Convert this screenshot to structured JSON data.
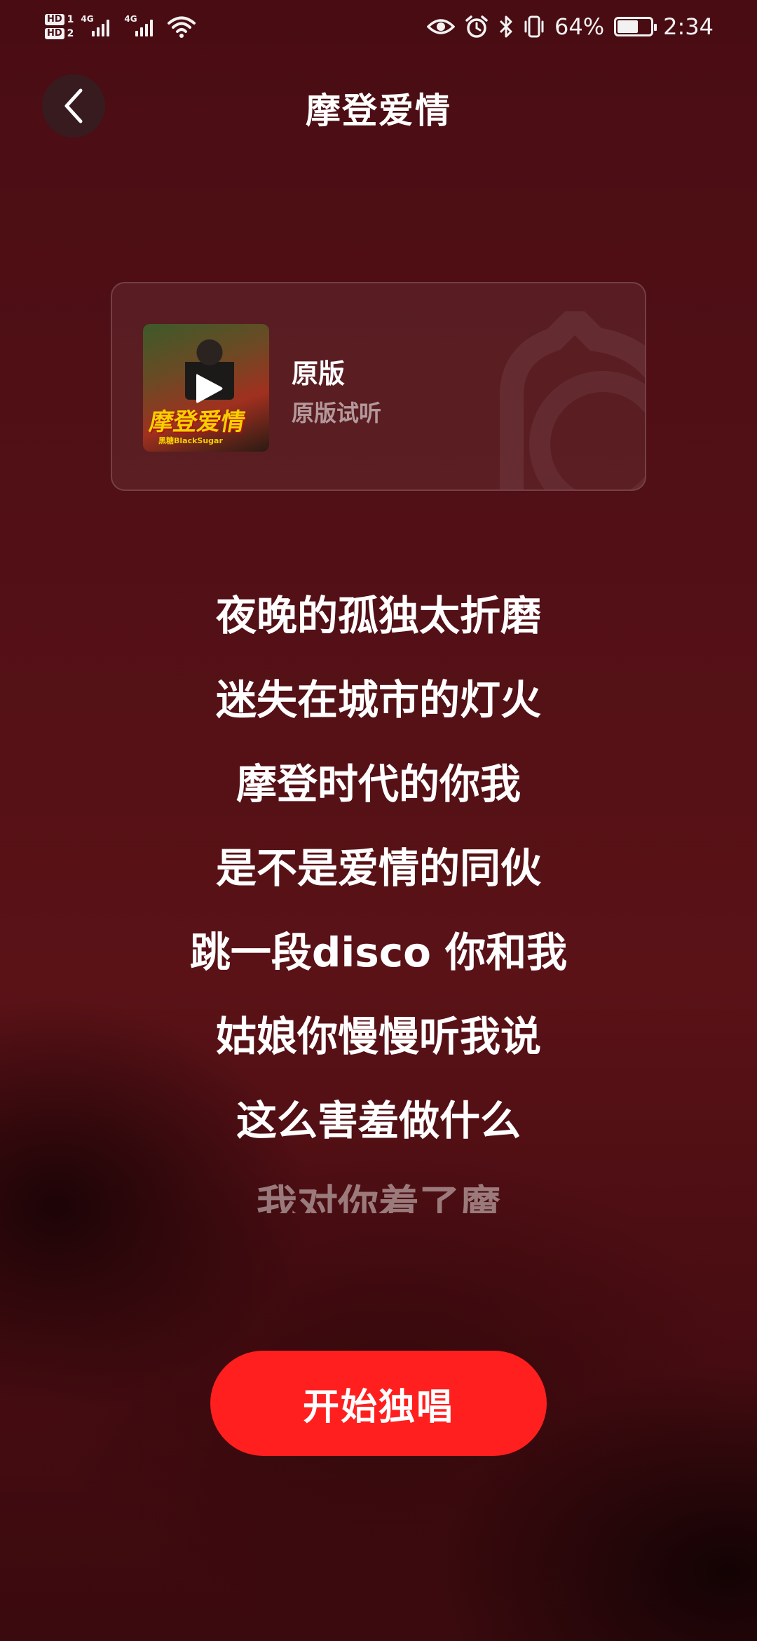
{
  "status_bar": {
    "hd1": "HD",
    "hd1_num": "1",
    "hd2": "HD",
    "hd2_num": "2",
    "net1": "4G",
    "net2": "4G",
    "battery": "64%",
    "battery_level": 0.64,
    "time": "2:34",
    "icons": [
      "eye-icon",
      "alarm-icon",
      "bluetooth-icon",
      "vibrate-icon",
      "battery-saver-icon"
    ]
  },
  "header": {
    "title": "摩登爱情",
    "back_icon": "chevron-left-icon"
  },
  "version_card": {
    "name": "原版",
    "description": "原版试听",
    "cover_title": "摩登爱情",
    "cover_subtitle": "黑糖BlackSugar",
    "play_icon": "play-icon"
  },
  "lyrics": [
    "夜晚的孤独太折磨",
    "迷失在城市的灯火",
    "摩登时代的你我",
    "是不是爱情的同伙",
    "跳一段disco 你和我",
    "姑娘你慢慢听我说",
    "这么害羞做什么",
    "我对你着了魔"
  ],
  "cta": {
    "label": "开始独唱"
  },
  "colors": {
    "accent": "#ff1f1f",
    "background": "#4f0f15"
  }
}
